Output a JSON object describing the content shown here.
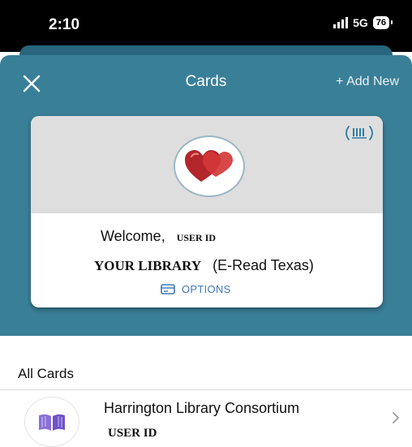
{
  "status_bar": {
    "time": "2:10",
    "network": "5G",
    "battery": "76"
  },
  "header": {
    "title": "Cards",
    "add_new": "+ Add New",
    "close_icon": "close-icon"
  },
  "current_card": {
    "welcome_label": "Welcome,",
    "user_id": "USER ID",
    "library_name": "YOUR LIBRARY",
    "library_subtitle": "(E-Read Texas)",
    "options_label": "OPTIONS",
    "logo_icon": "hearts-icon",
    "nfc_icon": "nfc-icon"
  },
  "all_cards": {
    "title": "All Cards",
    "items": [
      {
        "name": "Harrington Library Consortium",
        "user_id": "USER ID",
        "icon": "open-book-icon"
      }
    ]
  },
  "colors": {
    "panel": "#3a7f98",
    "panel_back": "#27667e",
    "card_top": "#dedede",
    "options_accent": "#3f79b8",
    "status_bar": "#000000"
  }
}
